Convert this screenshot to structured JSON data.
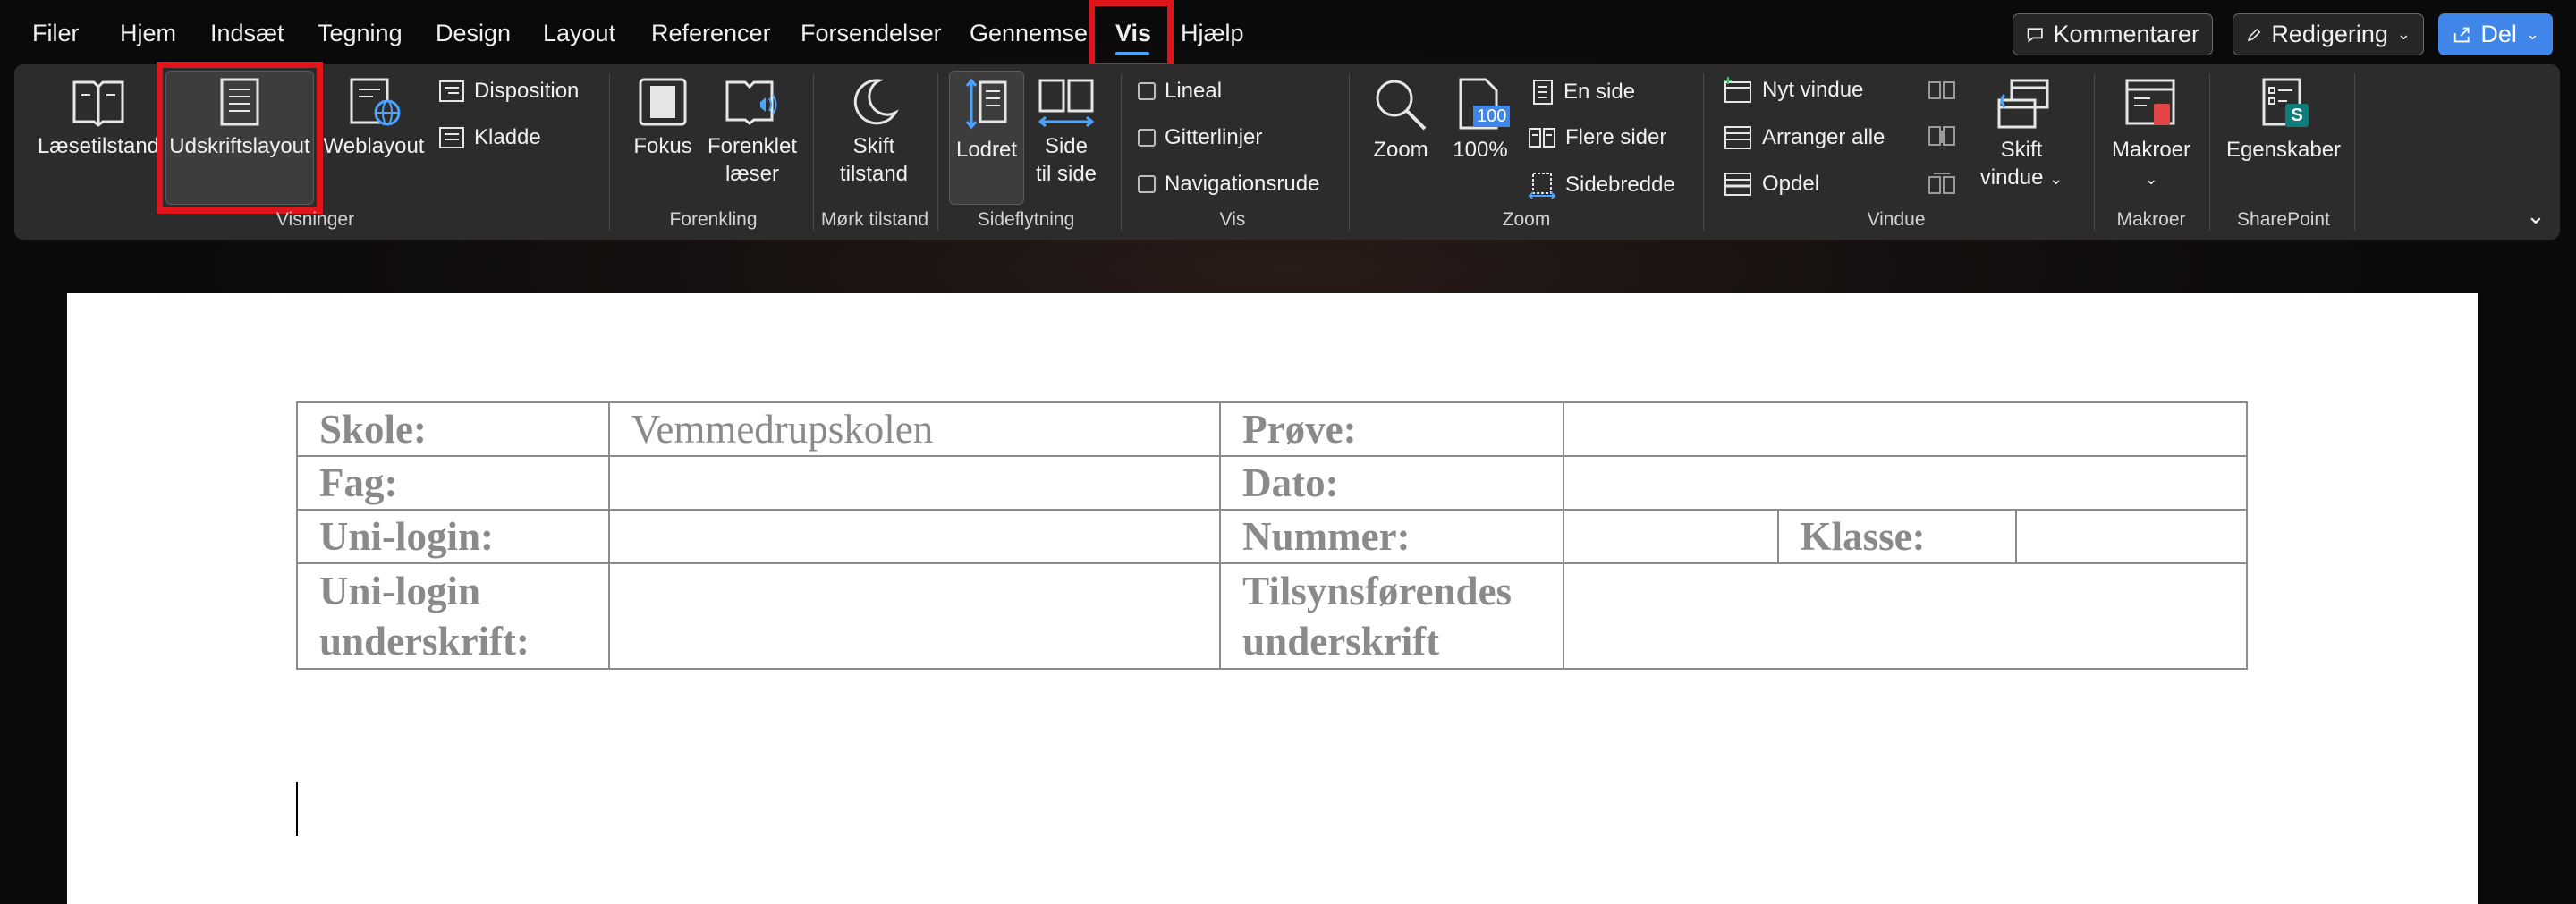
{
  "menubar": {
    "tabs": [
      "Filer",
      "Hjem",
      "Indsæt",
      "Tegning",
      "Design",
      "Layout",
      "Referencer",
      "Forsendelser",
      "Gennemse",
      "Vis",
      "Hjælp"
    ],
    "active_tab": "Vis",
    "comments_label": "Kommentarer",
    "editing_label": "Redigering",
    "share_label": "Del"
  },
  "ribbon": {
    "views": {
      "read_mode": "Læsetilstand",
      "print_layout": "Udskriftslayout",
      "web_layout": "Weblayout",
      "outline": "Disposition",
      "draft": "Kladde",
      "group": "Visninger"
    },
    "immersive": {
      "focus": "Fokus",
      "reader_line1": "Forenklet",
      "reader_line2": "læser",
      "group": "Forenkling"
    },
    "dark": {
      "switch_line1": "Skift",
      "switch_line2": "tilstand",
      "group": "Mørk tilstand"
    },
    "page_movement": {
      "vertical": "Lodret",
      "side_line1": "Side",
      "side_line2": "til side",
      "group": "Sideflytning"
    },
    "show": {
      "ruler": "Lineal",
      "gridlines": "Gitterlinjer",
      "nav_pane": "Navigationsrude",
      "group": "Vis"
    },
    "zoom": {
      "zoom": "Zoom",
      "hundred": "100%",
      "hundred_badge": "100",
      "one_page": "En side",
      "multiple_pages": "Flere sider",
      "page_width": "Sidebredde",
      "group": "Zoom"
    },
    "window": {
      "new_window": "Nyt vindue",
      "arrange_all": "Arranger alle",
      "split": "Opdel",
      "switch_line1": "Skift",
      "switch_line2": "vindue",
      "group": "Vindue"
    },
    "macros": {
      "label": "Makroer",
      "group": "Makroer"
    },
    "sharepoint": {
      "label": "Egenskaber",
      "badge": "S",
      "group": "SharePoint"
    }
  },
  "document": {
    "r1": {
      "l1": "Skole:",
      "v1": "Vemmedrupskolen",
      "l2": "Prøve:"
    },
    "r2": {
      "l1": "Fag:",
      "l2": "Dato:"
    },
    "r3": {
      "l1": "Uni-login:",
      "l2": "Nummer:",
      "l3": "Klasse:"
    },
    "r4": {
      "l1a": "Uni-login",
      "l1b": "underskrift:",
      "l2a": "Tilsynsførendes",
      "l2b": "underskrift"
    }
  }
}
